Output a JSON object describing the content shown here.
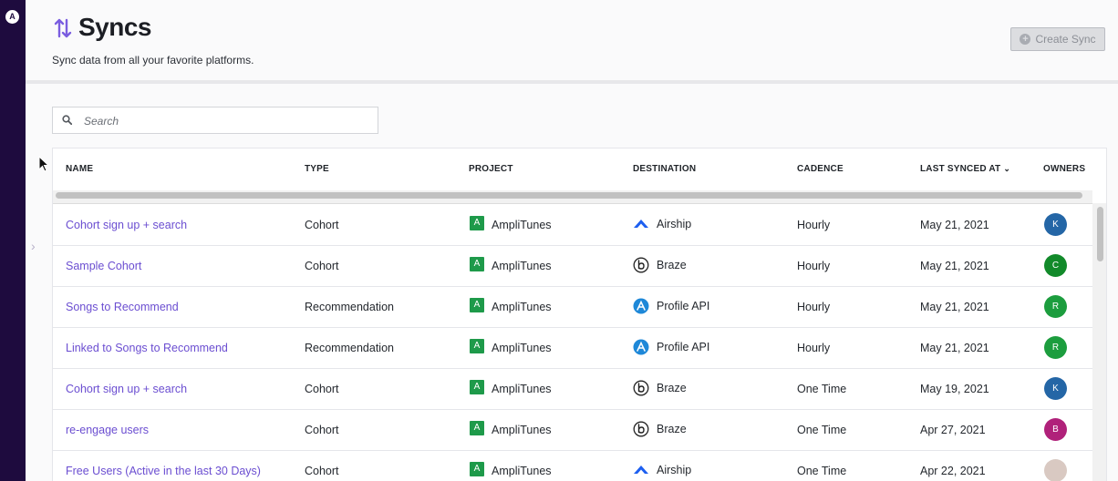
{
  "rail": {
    "logo_glyph": "A",
    "expand_glyph": "›"
  },
  "header": {
    "title": "Syncs",
    "subtitle": "Sync data from all your favorite platforms.",
    "create_button": "Create Sync"
  },
  "search": {
    "placeholder": "Search"
  },
  "table": {
    "columns": [
      "NAME",
      "TYPE",
      "PROJECT",
      "DESTINATION",
      "CADENCE",
      "LAST SYNCED AT",
      "OWNERS"
    ],
    "sort_glyph": "⌄",
    "rows": [
      {
        "name": "Cohort sign up + search",
        "type": "Cohort",
        "project_badge": "A",
        "project": "AmpliTunes",
        "destination": "Airship",
        "dest_icon": "airship-icon",
        "cadence": "Hourly",
        "last_synced": "May 21, 2021",
        "owner": "K",
        "owner_color": "#2466a6"
      },
      {
        "name": "Sample Cohort",
        "type": "Cohort",
        "project_badge": "A",
        "project": "AmpliTunes",
        "destination": "Braze",
        "dest_icon": "braze-icon",
        "cadence": "Hourly",
        "last_synced": "May 21, 2021",
        "owner": "C",
        "owner_color": "#128a2a"
      },
      {
        "name": "Songs to Recommend",
        "type": "Recommendation",
        "project_badge": "A",
        "project": "AmpliTunes",
        "destination": "Profile API",
        "dest_icon": "profile-api-icon",
        "cadence": "Hourly",
        "last_synced": "May 21, 2021",
        "owner": "R",
        "owner_color": "#1c9d3e"
      },
      {
        "name": "Linked to Songs to Recommend",
        "type": "Recommendation",
        "project_badge": "A",
        "project": "AmpliTunes",
        "destination": "Profile API",
        "dest_icon": "profile-api-icon",
        "cadence": "Hourly",
        "last_synced": "May 21, 2021",
        "owner": "R",
        "owner_color": "#1c9d3e"
      },
      {
        "name": "Cohort sign up + search",
        "type": "Cohort",
        "project_badge": "A",
        "project": "AmpliTunes",
        "destination": "Braze",
        "dest_icon": "braze-icon",
        "cadence": "One Time",
        "last_synced": "May 19, 2021",
        "owner": "K",
        "owner_color": "#2466a6"
      },
      {
        "name": "re-engage users",
        "type": "Cohort",
        "project_badge": "A",
        "project": "AmpliTunes",
        "destination": "Braze",
        "dest_icon": "braze-icon",
        "cadence": "One Time",
        "last_synced": "Apr 27, 2021",
        "owner": "B",
        "owner_color": "#b0217a"
      },
      {
        "name": "Free Users (Active in the last 30 Days)",
        "type": "Cohort",
        "project_badge": "A",
        "project": "AmpliTunes",
        "destination": "Airship",
        "dest_icon": "airship-icon",
        "cadence": "One Time",
        "last_synced": "Apr 22, 2021",
        "owner": "",
        "owner_color": "#d9c9c2"
      }
    ]
  },
  "colors": {
    "accent": "#6b4ed1",
    "rail": "#1e0b3e",
    "project_badge": "#1e9a4a"
  }
}
